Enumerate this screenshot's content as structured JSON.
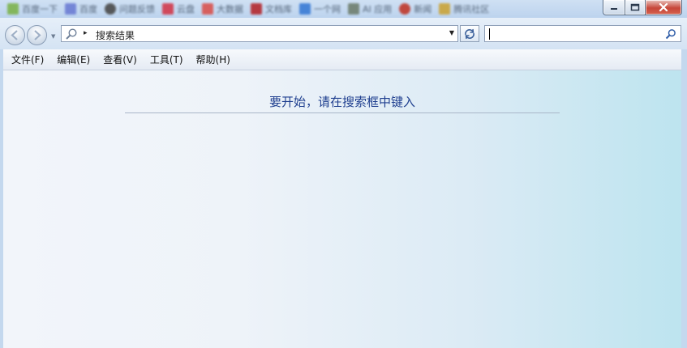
{
  "titlebar": {
    "tabs": [
      {
        "label": "百度一下",
        "color": "#7db34d"
      },
      {
        "label": "百度",
        "color": "#6c7dd4"
      },
      {
        "label": "问题反馈",
        "color": "#4a4a4a"
      },
      {
        "label": "云盘",
        "color": "#d23a4c"
      },
      {
        "label": "大数据",
        "color": "#d9534f"
      },
      {
        "label": "文档库",
        "color": "#b4282e"
      },
      {
        "label": "一个网",
        "color": "#3a7bd5"
      },
      {
        "label": "AI 应用",
        "color": "#6f7f6f"
      },
      {
        "label": "新闻",
        "color": "#c0392b"
      },
      {
        "label": "腾讯社区",
        "color": "#caa43a"
      }
    ],
    "controls": {
      "minimize_icon": "minimize-icon",
      "maximize_icon": "maximize-icon",
      "close_icon": "close-icon"
    }
  },
  "navigation": {
    "back_icon": "back-arrow-icon",
    "forward_icon": "forward-arrow-icon",
    "recent_icon": "recent-pages-dropdown-icon",
    "address": {
      "icon": "search-icon",
      "separator": "▸",
      "text": "搜索结果",
      "dropdown_icon": "chevron-down-icon"
    },
    "refresh_icon": "refresh-icon",
    "search_box": {
      "value": "",
      "icon": "search-icon"
    }
  },
  "menu": {
    "items": [
      {
        "label": "文件(F)"
      },
      {
        "label": "编辑(E)"
      },
      {
        "label": "查看(V)"
      },
      {
        "label": "工具(T)"
      },
      {
        "label": "帮助(H)"
      }
    ]
  },
  "content": {
    "prompt": "要开始，请在搜索框中键入"
  },
  "colors": {
    "prompt_text": "#1f3f8f",
    "content_gradient_end": "#bde4ef",
    "close_button": "#c7473a"
  }
}
